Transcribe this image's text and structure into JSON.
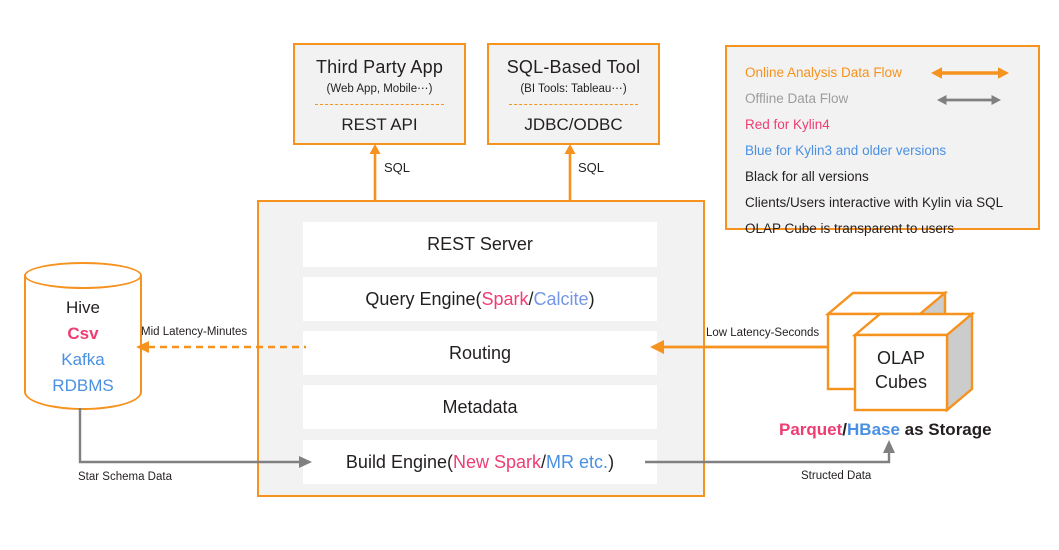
{
  "colors": {
    "orange": "#F6921E",
    "gray": "#808080",
    "legend_gray": "#9d9d9d",
    "pink": "#EE3D73",
    "blue": "#4A90E2",
    "blue_light": "#7596E8",
    "black": "#231f20",
    "panel_bg": "#f2f2f2",
    "row_bg": "#ffffff",
    "cube_side": "#cccccc"
  },
  "clients": [
    {
      "title": "Third Party App",
      "subtitle": "(Web App, Mobile⋯)",
      "api": "REST API",
      "arrow_label": "SQL"
    },
    {
      "title": "SQL-Based Tool",
      "subtitle": "(BI Tools: Tableau⋯)",
      "api": "JDBC/ODBC",
      "arrow_label": "SQL"
    }
  ],
  "legend": {
    "items": [
      {
        "bullet": "-",
        "text": "Online Analysis Data Flow",
        "color": "orange",
        "arrow": "orange"
      },
      {
        "bullet": "-",
        "text": "Offline Data Flow",
        "color": "legend_gray",
        "arrow": "gray"
      },
      {
        "bullet": "-",
        "text": "Red for Kylin4",
        "color": "pink",
        "arrow": null
      },
      {
        "bullet": "-",
        "text": "Blue for Kylin3 and older versions",
        "color": "blue",
        "arrow": null
      },
      {
        "bullet": "-",
        "text": "Black for all versions",
        "color": "black",
        "arrow": null
      },
      {
        "bullet": "-",
        "text": "Clients/Users interactive with Kylin via SQL",
        "color": "black",
        "arrow": null
      },
      {
        "bullet": "-",
        "text": "OLAP Cube is transparent to users",
        "color": "black",
        "arrow": null
      }
    ]
  },
  "server_panel": {
    "rows": [
      {
        "name": "rest-server",
        "parts": [
          {
            "t": "REST Server",
            "c": "black"
          }
        ]
      },
      {
        "name": "query-engine",
        "parts": [
          {
            "t": "Query Engine(",
            "c": "black"
          },
          {
            "t": "Spark",
            "c": "pink"
          },
          {
            "t": "/",
            "c": "black"
          },
          {
            "t": "Calcite",
            "c": "blue_light"
          },
          {
            "t": ")",
            "c": "black"
          }
        ]
      },
      {
        "name": "routing",
        "parts": [
          {
            "t": "Routing",
            "c": "black"
          }
        ]
      },
      {
        "name": "metadata",
        "parts": [
          {
            "t": "Metadata",
            "c": "black"
          }
        ]
      },
      {
        "name": "build-engine",
        "parts": [
          {
            "t": "Build Engine(",
            "c": "black"
          },
          {
            "t": "New Spark",
            "c": "pink"
          },
          {
            "t": "/",
            "c": "black"
          },
          {
            "t": "MR etc.",
            "c": "blue"
          },
          {
            "t": ")",
            "c": "black"
          }
        ]
      }
    ]
  },
  "datasource": {
    "lines": [
      {
        "t": "Hive",
        "c": "black"
      },
      {
        "t": "Csv",
        "c": "pink"
      },
      {
        "t": "Kafka",
        "c": "blue"
      },
      {
        "t": "RDBMS",
        "c": "blue"
      }
    ]
  },
  "storage": {
    "cube_label_line1": "OLAP",
    "cube_label_line2": "Cubes",
    "storage_parts": [
      {
        "t": "Parquet",
        "c": "pink"
      },
      {
        "t": "/",
        "c": "black"
      },
      {
        "t": "HBase",
        "c": "blue"
      },
      {
        "t": " as Storage",
        "c": "black"
      }
    ]
  },
  "connectors": {
    "mid_latency": "Mid Latency-Minutes",
    "low_latency": "Low Latency-Seconds",
    "star_schema": "Star Schema Data",
    "structed_data": "Structed Data"
  }
}
